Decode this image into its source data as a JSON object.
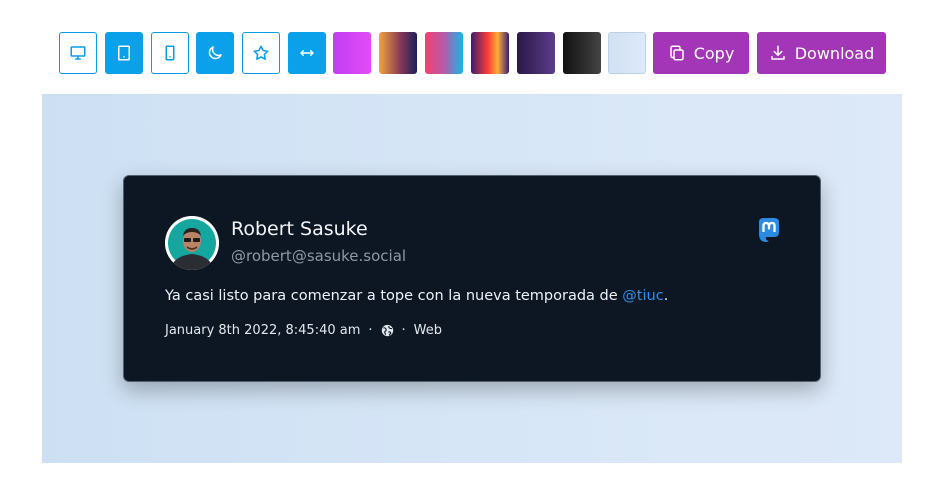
{
  "toolbar": {
    "icon_buttons": [
      {
        "icon": "monitor-icon",
        "style": "outline"
      },
      {
        "icon": "tablet-icon",
        "style": "filled"
      },
      {
        "icon": "phone-icon",
        "style": "outline"
      },
      {
        "icon": "moon-icon",
        "style": "filled"
      },
      {
        "icon": "star-icon",
        "style": "outline"
      },
      {
        "icon": "arrows-horizontal-icon",
        "style": "filled"
      }
    ],
    "swatches": [
      {
        "from": "#c13ef2",
        "to": "#e44cf5"
      },
      {
        "from": "#f0a53a",
        "to": "#1b1f5c"
      },
      {
        "from": "#f2416f",
        "to": "#10b9e6"
      },
      {
        "from": "#ff3d35",
        "to": "#3a1d6e"
      },
      {
        "from": "#2b1846",
        "to": "#5b3d8e"
      },
      {
        "from": "#111111",
        "to": "#444444"
      },
      {
        "from": "#d2e2f4",
        "to": "#dce9f8"
      }
    ],
    "copy_label": "Copy",
    "download_label": "Download",
    "accent": "#0ba0ea",
    "action_color": "#a236b6"
  },
  "post": {
    "name": "Robert Sasuke",
    "handle": "@robert@sasuke.social",
    "text_before": "Ya casi listo para comenzar a tope con la nueva temporada de ",
    "mention": "@tiuc",
    "text_after": ".",
    "date": "January 8th 2022, 8:45:40 am",
    "sep1": "·",
    "sep2": "·",
    "visibility_icon": "globe-icon",
    "client": "Web",
    "brand_icon": "mastodon-icon",
    "brand_color": "#2a8be0"
  }
}
